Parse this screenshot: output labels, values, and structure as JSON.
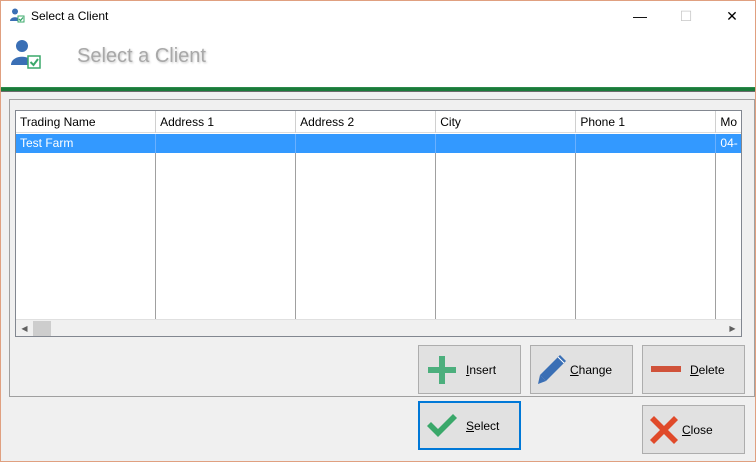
{
  "window": {
    "title": "Select a Client",
    "minimize_glyph": "—",
    "maximize_glyph": "☐",
    "close_glyph": "✕"
  },
  "header": {
    "heading": "Select a Client"
  },
  "grid": {
    "columns": [
      "Trading Name",
      "Address 1",
      "Address 2",
      "City",
      "Phone 1",
      "Mo"
    ],
    "rows": [
      [
        "Test Farm",
        "",
        "",
        "",
        "",
        "04-"
      ]
    ]
  },
  "buttons": {
    "insert": {
      "first": "I",
      "rest": "nsert"
    },
    "change": {
      "first": "C",
      "rest": "hange"
    },
    "delete": {
      "first": "D",
      "rest": "elete"
    },
    "select": {
      "first": "S",
      "rest": "elect"
    },
    "close": {
      "first": "C",
      "rest": "lose"
    }
  },
  "colors": {
    "selection": "#3399ff",
    "header_line": "#1a7a3a",
    "insert_icon": "#4caf7d",
    "change_icon": "#3a6fb5",
    "delete_icon": "#d0523a",
    "select_icon": "#3aa86a",
    "close_icon": "#e04a2a"
  },
  "icons": {
    "app": "user-check-icon",
    "header": "user-check-icon",
    "insert": "plus-icon",
    "change": "pencil-icon",
    "delete": "minus-icon",
    "select": "checkmark-icon",
    "close": "x-icon"
  }
}
